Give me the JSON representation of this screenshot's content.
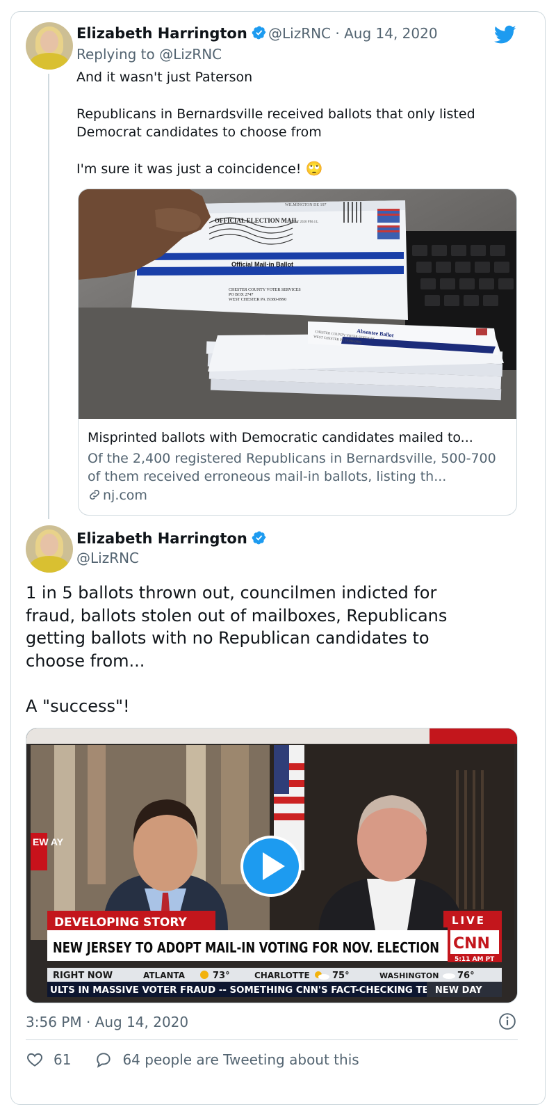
{
  "tweet1": {
    "author": "Elizabeth Harrington",
    "handle_date": "@LizRNC · Aug 14, 2020",
    "replying_to": "Replying to @LizRNC",
    "body": "And it wasn't just Paterson\n\nRepublicans in Bernardsville received ballots that only listed\nDemocrat candidates to choose from\n\nI'm sure it was just a coincidence!",
    "emoji": "🙄",
    "link_card": {
      "image_text": {
        "envelope_label": "Official Mail-in Ballot",
        "envelope_logo": "OFFICIAL ELECTION MAIL",
        "postmark": "WILMINGTON DE 197",
        "postmark_date": "28 MAY 2020 PM 4 L",
        "address": [
          "CHESTER COUNTY VOTER SERVICES",
          "PO BOX 2747",
          "WEST CHESTER PA 19380-0990"
        ],
        "stack_label": "Absentee Ballot",
        "stack_address": [
          "CHESTER COUNTY VOTER SERVICES",
          "WEST CHESTER PA 19380-0990"
        ]
      },
      "title": "Misprinted ballots with Democratic candidates mailed to...",
      "description": "Of the 2,400 registered Republicans in Bernardsville, 500-700 of them received erroneous mail-in ballots, listing th...",
      "domain": "nj.com"
    }
  },
  "tweet2": {
    "author": "Elizabeth Harrington",
    "handle": "@LizRNC",
    "body": "1 in 5 ballots thrown out, councilmen indicted for\nfraud, ballots stolen out of mailboxes, Republicans\ngetting ballots with no Republican candidates to\nchoose from...\n\nA \"success\"!",
    "video": {
      "side_bug": "EW AY",
      "banner_top": "DEVELOPING STORY",
      "headline": "NEW JERSEY TO ADOPT MAIL-IN VOTING FOR NOV. ELECTION",
      "live": "LIVE",
      "network": "CNN",
      "clock": "5:11 AM PT",
      "weather": [
        {
          "label": "RIGHT NOW",
          "value": ""
        },
        {
          "label": "ATLANTA",
          "value": "73°"
        },
        {
          "label": "CHARLOTTE",
          "value": "75°"
        },
        {
          "label": "WASHINGTON",
          "value": "76°"
        }
      ],
      "ticker": "ULTS IN MASSIVE VOTER FRAUD -- SOMETHING CNN'S FACT-CHECKING TEAI",
      "show": "NEW DAY"
    },
    "timestamp": "3:56 PM · Aug 14, 2020",
    "likes": "61",
    "tweeting_about": "64 people are Tweeting about this"
  },
  "colors": {
    "brand": "#1d9bf0",
    "text": "#0f1419",
    "muted": "#536471",
    "border": "#cfd9de",
    "cnn_red": "#cc0000"
  },
  "icons": [
    "twitter-bird-icon",
    "verified-badge-icon",
    "link-icon",
    "play-icon",
    "info-icon",
    "heart-icon",
    "reply-bubble-icon"
  ]
}
